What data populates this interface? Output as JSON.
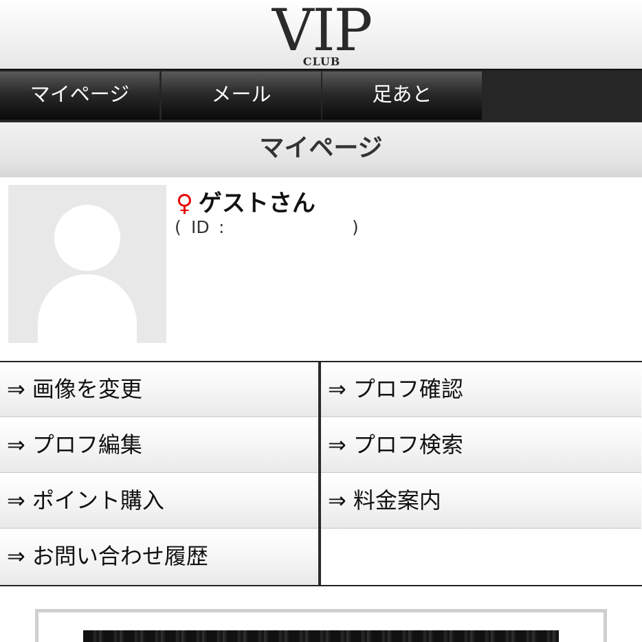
{
  "header": {
    "logo_main": "VIP",
    "logo_sub": "CLUB"
  },
  "nav": {
    "items": [
      {
        "label": "マイページ"
      },
      {
        "label": "メール"
      },
      {
        "label": "足あと"
      }
    ]
  },
  "page_title": "マイページ",
  "profile": {
    "gender_icon": "♀",
    "gender_icon_name": "female-symbol-icon",
    "gender_color": "#e60000",
    "name": "ゲストさん",
    "id_open": "(",
    "id_label": "ID",
    "id_colon": ":",
    "id_value": "",
    "id_close": ")"
  },
  "menu": {
    "arrow": "⇒",
    "items": [
      {
        "label": "画像を変更"
      },
      {
        "label": "プロフ確認"
      },
      {
        "label": "プロフ編集"
      },
      {
        "label": "プロフ検索"
      },
      {
        "label": "ポイント購入"
      },
      {
        "label": "料金案内"
      },
      {
        "label": "お問い合わせ履歴"
      }
    ]
  }
}
